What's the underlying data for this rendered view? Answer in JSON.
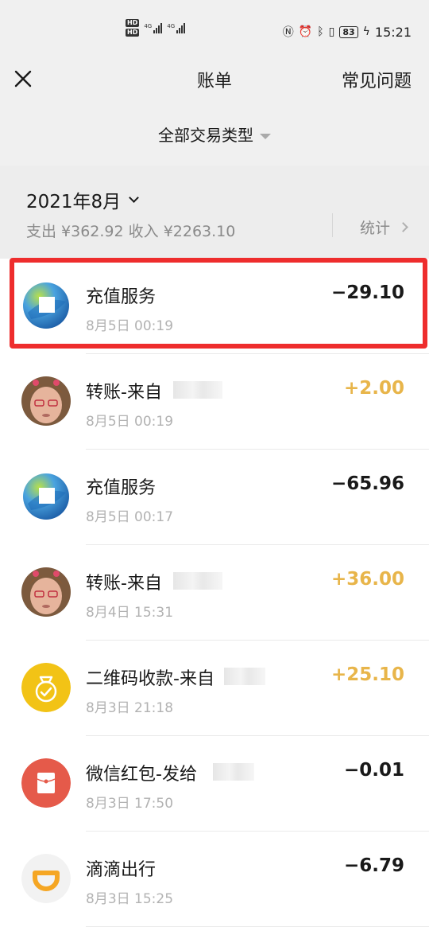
{
  "status": {
    "sim1": "HD",
    "sim2": "HD",
    "net1": "4G",
    "net2": "4G",
    "battery": "83",
    "time": "15:21"
  },
  "nav": {
    "title": "账单",
    "faq": "常见问题"
  },
  "filter": {
    "label": "全部交易类型"
  },
  "month": {
    "label": "2021年8月",
    "summary": "支出 ¥362.92 收入 ¥2263.10",
    "stats_label": "统计"
  },
  "transactions": [
    {
      "title": "充值服务",
      "time": "8月5日 00:19",
      "amount": "−29.10",
      "icon": "recharge-service-icon"
    },
    {
      "title": "转账-来自",
      "time": "8月5日 00:19",
      "amount": "+2.00",
      "icon": "user-avatar"
    },
    {
      "title": "充值服务",
      "time": "8月5日 00:17",
      "amount": "−65.96",
      "icon": "recharge-service-icon"
    },
    {
      "title": "转账-来自",
      "time": "8月4日 15:31",
      "amount": "+36.00",
      "icon": "user-avatar"
    },
    {
      "title": "二维码收款-来自",
      "time": "8月3日 21:18",
      "amount": "+25.10",
      "icon": "money-bag-icon"
    },
    {
      "title": "微信红包-发给",
      "time": "8月3日 17:50",
      "amount": "−0.01",
      "icon": "red-packet-icon"
    },
    {
      "title": "滴滴出行",
      "time": "8月3日 15:25",
      "amount": "−6.79",
      "icon": "didi-icon"
    }
  ],
  "colors": {
    "highlight": "#ee2d2d",
    "income": "#e8b54a",
    "expense": "#191919",
    "money_bag": "#f2c316",
    "red_packet": "#e55a4a",
    "didi": "#f5a623"
  }
}
